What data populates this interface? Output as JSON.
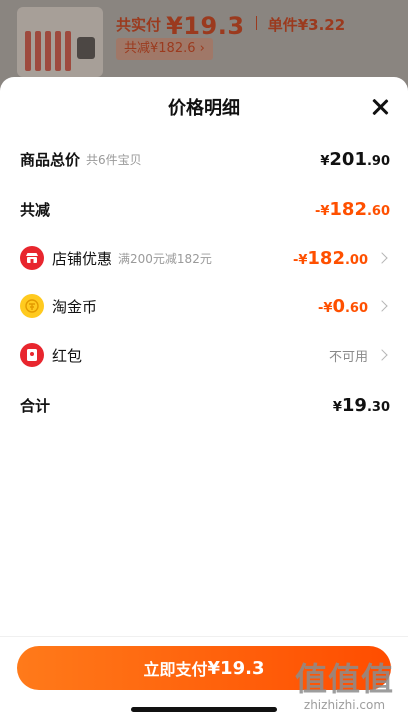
{
  "background": {
    "total_label": "共实付",
    "total_value": "¥19.3",
    "unit_price": "单件¥3.22",
    "reduce_badge": "共减¥182.6 ›"
  },
  "sheet": {
    "title": "价格明细",
    "rows": [
      {
        "label": "商品总价",
        "sub": "共6件宝贝",
        "amount_symbol": "¥",
        "amount_int": "201",
        "amount_dec": ".90"
      },
      {
        "label": "共减",
        "amount_symbol": "-¥",
        "amount_int": "182",
        "amount_dec": ".60"
      },
      {
        "label": "店铺优惠",
        "sub": "满200元减182元",
        "amount_symbol": "-¥",
        "amount_int": "182",
        "amount_dec": ".00"
      },
      {
        "label": "淘金币",
        "amount_symbol": "-¥",
        "amount_int": "0",
        "amount_dec": ".60"
      },
      {
        "label": "红包",
        "status": "不可用"
      },
      {
        "label": "合计",
        "amount_symbol": "¥",
        "amount_int": "19",
        "amount_dec": ".30"
      }
    ]
  },
  "bottom": {
    "pay_label": "立即支付",
    "pay_amount": "¥19.3"
  },
  "watermark": {
    "big": "值值值",
    "url": "zhizhizhi.com"
  },
  "colors": {
    "accent": "#ff5000",
    "shop_icon": "#e8262e",
    "coin_icon": "#ffca1f"
  },
  "icons": {
    "close": "close-icon",
    "shop": "shop-icon",
    "coin": "coin-icon",
    "red_packet": "red-packet-icon",
    "chevron": "chevron-right-icon"
  }
}
